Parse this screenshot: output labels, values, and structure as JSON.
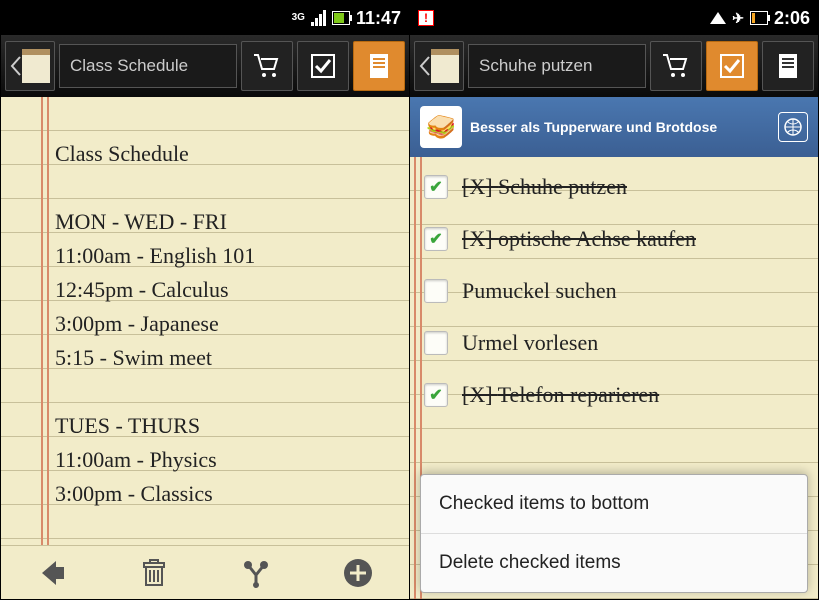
{
  "left": {
    "status": {
      "network": "3G",
      "time": "11:47"
    },
    "appbar": {
      "title": "Class Schedule"
    },
    "note": {
      "title": "Class Schedule",
      "lines": [
        "MON - WED - FRI",
        "11:00am - English 101",
        "12:45pm - Calculus",
        "3:00pm - Japanese",
        "5:15 - Swim meet",
        "",
        "TUES - THURS",
        "11:00am - Physics",
        "3:00pm - Classics"
      ]
    }
  },
  "right": {
    "status": {
      "time": "2:06"
    },
    "appbar": {
      "title": "Schuhe putzen"
    },
    "banner": {
      "text": "Besser als Tupperware und Brotdose"
    },
    "items": [
      {
        "label": "Schuhe putzen",
        "checked": true
      },
      {
        "label": "optische Achse kaufen",
        "checked": true
      },
      {
        "label": "Pumuckel suchen",
        "checked": false
      },
      {
        "label": "Urmel vorlesen",
        "checked": false
      },
      {
        "label": "Telefon reparieren",
        "checked": true
      }
    ],
    "menu": {
      "opt1": "Checked items to bottom",
      "opt2": "Delete checked items"
    }
  }
}
